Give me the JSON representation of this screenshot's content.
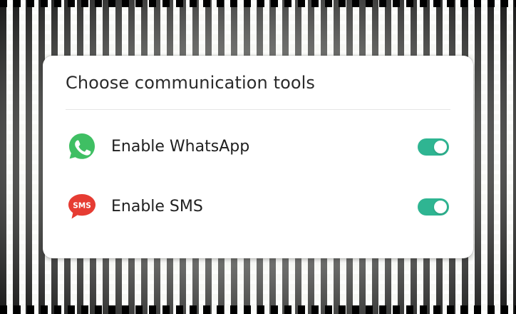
{
  "panel": {
    "title": "Choose communication tools"
  },
  "options": [
    {
      "label": "Enable WhatsApp",
      "icon": "whatsapp-icon",
      "enabled": true
    },
    {
      "label": "Enable SMS",
      "icon": "sms-icon",
      "icon_text": "SMS",
      "enabled": true
    }
  ],
  "colors": {
    "toggle_on": "#2fb592",
    "whatsapp_green": "#3fbf63",
    "sms_red": "#e63c33",
    "card_background": "#ffffff",
    "title_text": "#2b2b2b"
  }
}
